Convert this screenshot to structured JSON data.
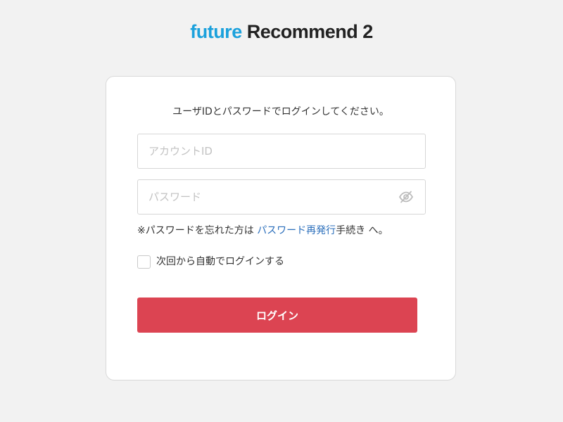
{
  "logo": {
    "part1": "future",
    "part2": " Recommend 2",
    "color_accent": "#1ba1dc",
    "color_dark": "#222222"
  },
  "login": {
    "intro": "ユーザIDとパスワードでログインしてください。",
    "account_placeholder": "アカウントID",
    "account_value": "",
    "password_placeholder": "パスワード",
    "password_value": "",
    "password_toggle_icon": "eye-off-icon",
    "forgot_prefix": "※パスワードを忘れた方は ",
    "forgot_link": "パスワード再発行",
    "forgot_suffix": "手続き へ。",
    "remember_label": "次回から自動でログインする",
    "remember_checked": false,
    "button_label": "ログイン",
    "button_color": "#dc4452",
    "link_color": "#2a6ebb"
  }
}
